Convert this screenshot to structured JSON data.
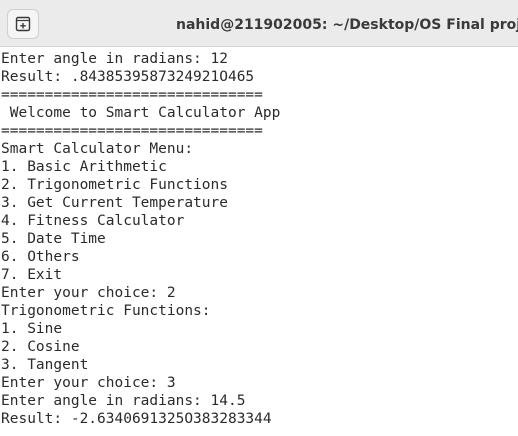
{
  "window": {
    "title": "nahid@211902005: ~/Desktop/OS Final project",
    "new_tab_icon": "new-tab-icon"
  },
  "terminal": {
    "lines": [
      "Enter angle in radians: 12",
      "Result: .8438539587324921O465",
      "==============================",
      " Welcome to Smart Calculator App",
      "==============================",
      "Smart Calculator Menu:",
      "1. Basic Arithmetic",
      "2. Trigonometric Functions",
      "3. Get Current Temperature",
      "4. Fitness Calculator",
      "5. Date Time",
      "6. Others",
      "7. Exit",
      "Enter your choice: 2",
      "Trigonometric Functions:",
      "1. Sine",
      "2. Cosine",
      "3. Tangent",
      "Enter your choice: 3",
      "Enter angle in radians: 14.5",
      "Result: -2.6340691325O383283344"
    ]
  }
}
